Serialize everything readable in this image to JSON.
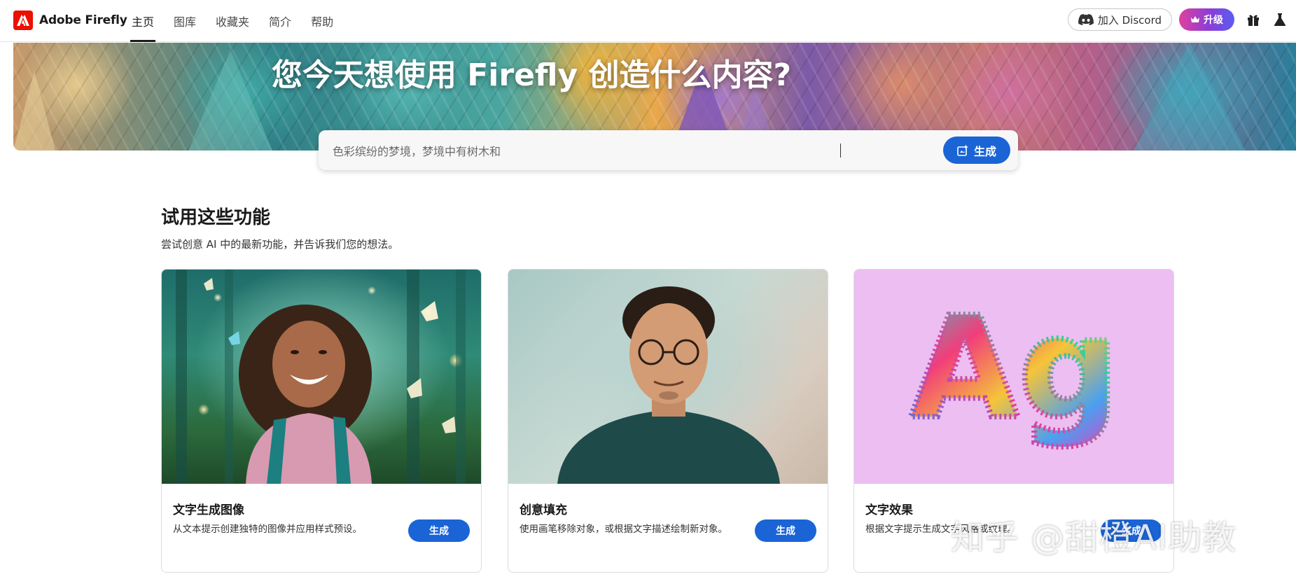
{
  "brand": {
    "name": "Adobe Firefly"
  },
  "nav": {
    "tabs": [
      {
        "label": "主页",
        "active": true
      },
      {
        "label": "图库",
        "active": false
      },
      {
        "label": "收藏夹",
        "active": false
      },
      {
        "label": "简介",
        "active": false
      },
      {
        "label": "帮助",
        "active": false
      }
    ],
    "discord_label": "加入 Discord",
    "upgrade_label": "升级"
  },
  "hero": {
    "title": "您今天想使用 Firefly 创造什么内容?",
    "prompt_value": "色彩缤纷的梦境，梦境中有树木和",
    "generate_label": "生成"
  },
  "features": {
    "title": "试用这些功能",
    "subtitle": "尝试创意 AI 中的最新功能，并告诉我们您的想法。",
    "cards": [
      {
        "title": "文字生成图像",
        "description": "从文本提示创建独特的图像并应用样式预设。",
        "button_label": "生成"
      },
      {
        "title": "创意填充",
        "description": "使用画笔移除对象，或根据文字描述绘制新对象。",
        "button_label": "生成"
      },
      {
        "title": "文字效果",
        "description": "根据文字提示生成文字风格或纹理。",
        "button_label": "生成",
        "image_text": "Ag"
      }
    ]
  },
  "watermark": "知乎 @甜橙AI助教",
  "colors": {
    "accent": "#1a64d6",
    "brand_red": "#eb1000",
    "upgrade_gradient_start": "#e0409e",
    "upgrade_gradient_end": "#5b5df0"
  },
  "icons": {
    "brand": "adobe-logo-icon",
    "discord": "discord-icon",
    "upgrade": "crown-icon",
    "gift": "gift-icon",
    "lab": "flask-icon",
    "generate": "generate-sparkle-icon"
  }
}
